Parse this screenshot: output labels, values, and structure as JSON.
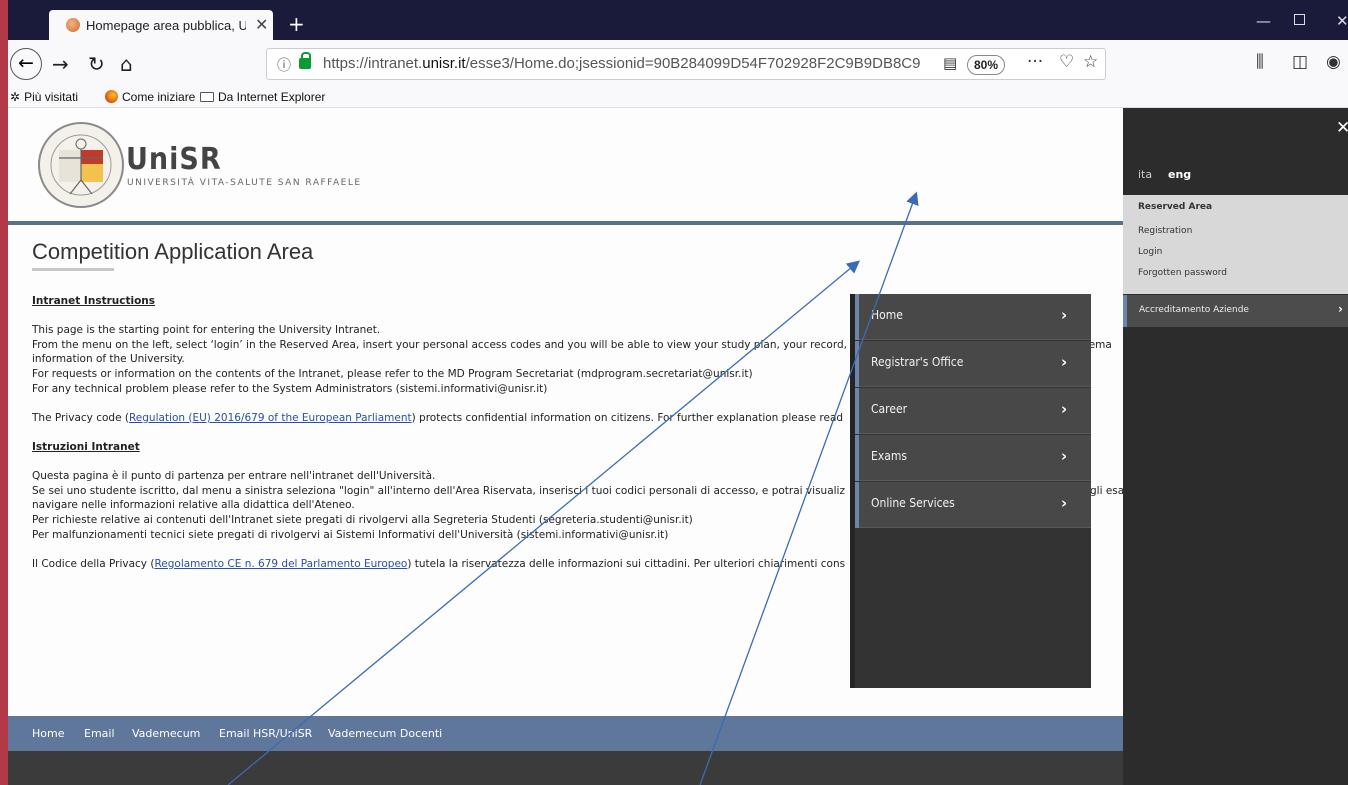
{
  "browser": {
    "tab_title": "Homepage area pubblica, Univ",
    "url_prefix": "https://intranet.",
    "url_domain": "unisr.it",
    "url_rest": "/esse3/Home.do;jsessionid=90B284099D54F702928F2C9B9DB8C9",
    "zoom": "80%",
    "new_tab": "+",
    "more": "···",
    "bookmarks": [
      "Più visitati",
      "Come iniziare",
      "Da Internet Explorer"
    ]
  },
  "brand": {
    "name": "UniSR",
    "subtitle": "UNIVERSITÀ VITA-SALUTE SAN RAFFAELE"
  },
  "page": {
    "title": "Competition Application Area",
    "en_heading": "Intranet Instructions",
    "en_lines": [
      "This page is the starting point for entering the University Intranet.",
      "From the menu on the left, select ‘login’ in the Reserved Area, insert your personal access codes and you will be able to view your study plan, your record,",
      "information of the University.",
      "For requests or information on the contents of the Intranet, please refer to the MD Program Secretariat (mdprogram.secretariat@unisr.it)",
      "For any technical problem please refer to the System Administrators (sistemi.informativi@unisr.it)"
    ],
    "en_tail_right": "al ema",
    "privacy_en_pre": "The Privacy code (",
    "privacy_en_link": "Regulation (EU) 2016/679 of the European Parliament",
    "privacy_en_post": ") protects confidential information on citizens. For further explanation please read",
    "it_heading": "Istruzioni Intranet",
    "it_lines": [
      "Questa pagina è il punto di partenza per entrare nell'intranet dell'Università.",
      "Se sei uno studente iscritto, dal menu a sinistra seleziona \"login\" all'interno dell'Area Riservata, inserisci i tuoi codici personali di accesso, e potrai visualiz",
      "navigare nelle informazioni relative alla didattica dell'Ateneo.",
      "Per richieste relative ai contenuti dell'Intranet siete pregati di rivolgervi alla Segreteria Studenti (segreteria.studenti@unisr.it)",
      "Per malfunzionamenti tecnici siete pregati di rivolgervi ai Sistemi Informativi dell'Università (sistemi.informativi@unisr.it)"
    ],
    "it_tail_right": "gli esa",
    "privacy_it_pre": "Il Codice della Privacy (",
    "privacy_it_link": "Regolamento CE n. 679 del Parlamento Europeo",
    "privacy_it_post": ") tutela la riservatezza delle informazioni sui cittadini. Per ulteriori chiarimenti cons"
  },
  "footer": {
    "links": [
      "Home",
      "Email",
      "Vademecum",
      "Email HSR/UniSR",
      "Vademecum Docenti"
    ]
  },
  "side_panel": {
    "close": "✕",
    "lang_ita": "ita",
    "lang_eng": "eng",
    "reserved_head": "Reserved Area",
    "reserved_items": [
      "Registration",
      "Login",
      "Forgotten password"
    ],
    "nav_item": "Accreditamento Aziende"
  },
  "popup_menu": {
    "items": [
      "Home",
      "Registrar's Office",
      "Career",
      "Exams",
      "Online Services"
    ]
  },
  "colors": {
    "accent_blue": "#5e779a",
    "panel_dark": "#2c2c2c",
    "link": "#2a4fa8"
  }
}
